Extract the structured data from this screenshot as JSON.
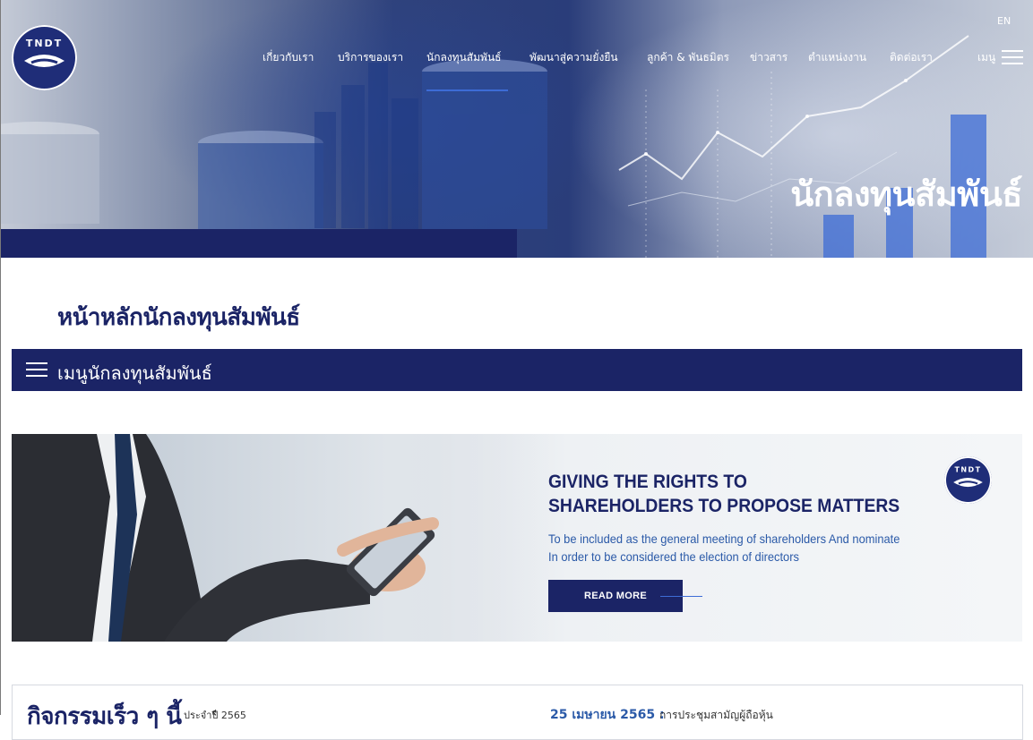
{
  "header": {
    "lang": "EN",
    "nav": [
      {
        "label": "เกี่ยวกับเรา"
      },
      {
        "label": "บริการของเรา"
      },
      {
        "label": "นักลงทุนสัมพันธ์"
      },
      {
        "label": "พัฒนาสู่ความยั่งยืน"
      },
      {
        "label": "ลูกค้า & พันธมิตร"
      },
      {
        "label": "ข่าวสาร"
      },
      {
        "label": "ตำแหน่งงาน"
      },
      {
        "label": "ติดต่อเรา"
      }
    ],
    "menu_label": "เมนู",
    "logo_text": "TNDT"
  },
  "hero": {
    "title": "นักลงทุนสัมพันธ์"
  },
  "main": {
    "heading": "หน้าหลักนักลงทุนสัมพันธ์",
    "ir_menu_label": "เมนูนักลงทุนสัมพันธ์"
  },
  "banner": {
    "title_line1": "GIVING THE RIGHTS TO",
    "title_line2": "SHAREHOLDERS TO PROPOSE MATTERS",
    "desc_line1": "To be included as the general meeting of shareholders And nominate",
    "desc_line2": "In order to be considered the election of directors",
    "button": "READ MORE",
    "logo_text": "TNDT"
  },
  "news": {
    "title": "กิจกรรมเร็ว ๆ นี้",
    "sub": "ประจำปี 2565",
    "date": "25 เมษายน 2565 :",
    "text": "การประชุมสามัญผู้ถือหุ้น"
  },
  "colors": {
    "primary": "#1b2466",
    "accent": "#3d6cd6",
    "link_blue": "#2b5aa8"
  }
}
